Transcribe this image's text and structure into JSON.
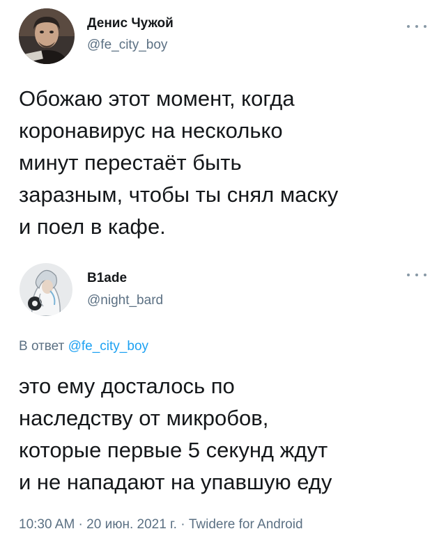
{
  "tweet_1": {
    "display_name": "Денис Чужой",
    "handle": "@fe_city_boy",
    "text": "Обожаю этот момент, когда\nкоронавирус на несколько\nминут перестаёт быть\nзаразным, чтобы ты снял маску\nи поел в кафе.",
    "avatar_icon": "user-avatar-photo"
  },
  "tweet_2": {
    "display_name": "B1ade",
    "handle": "@night_bard",
    "reply_prefix": "В ответ",
    "reply_mention": "@fe_city_boy",
    "text": "это ему досталось по\nнаследству от микробов,\nкоторые первые 5 секунд ждут\nи не нападают на упавшую еду",
    "time": "10:30 AM",
    "separator": " · ",
    "date": "20 июн. 2021 г.",
    "client": "Twidere for Android",
    "avatar_icon": "user-avatar-illustration"
  },
  "colors": {
    "text_primary": "#14171a",
    "text_secondary": "#5b7083",
    "link": "#1da1f2",
    "background": "#ffffff"
  }
}
